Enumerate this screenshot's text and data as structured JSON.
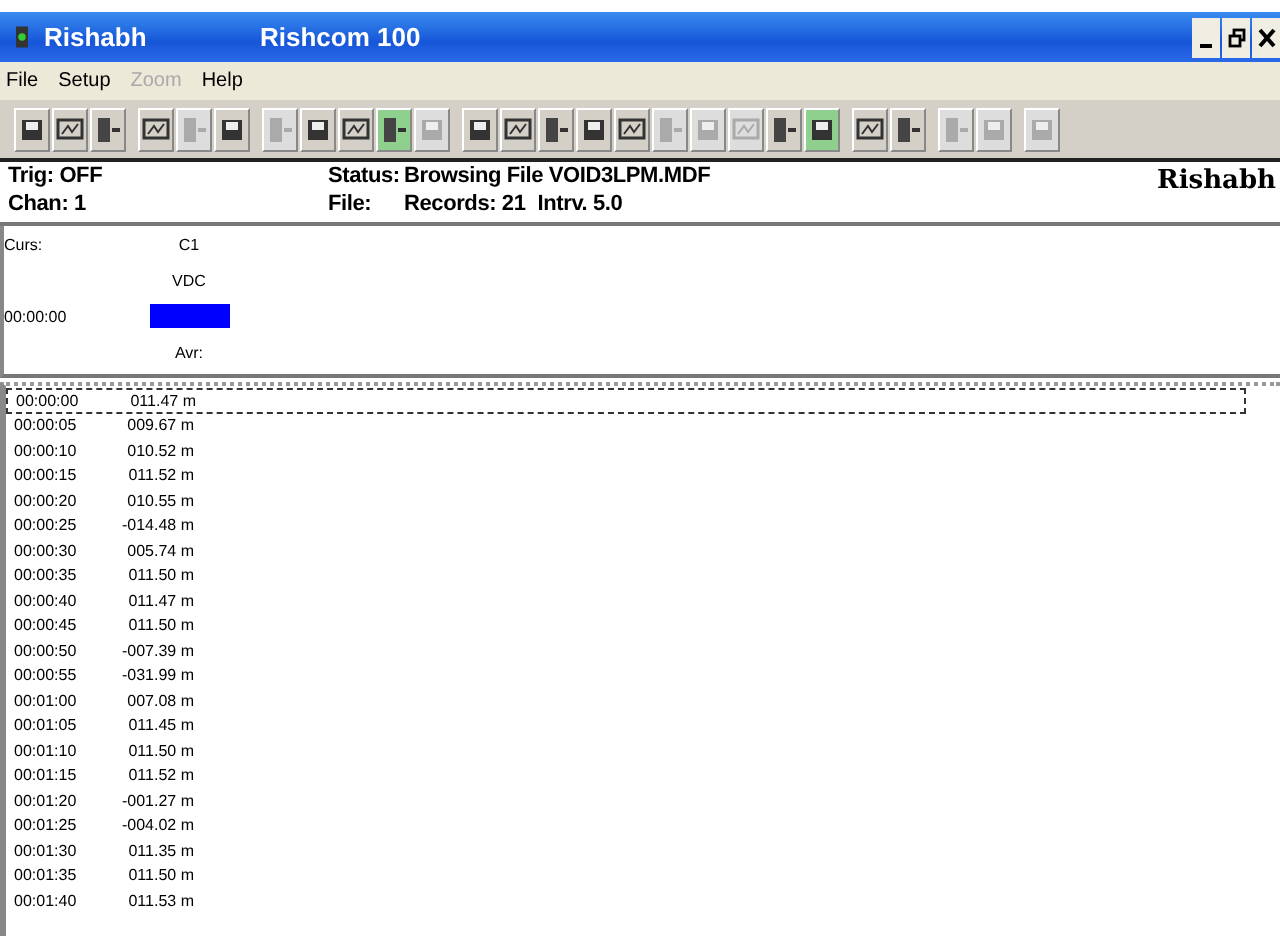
{
  "window": {
    "app_name": "Rishabh",
    "title": "Rishcom 100"
  },
  "menu": [
    {
      "label": "File",
      "disabled": false
    },
    {
      "label": "Setup",
      "disabled": false
    },
    {
      "label": "Zoom",
      "disabled": true
    },
    {
      "label": "Help",
      "disabled": false
    }
  ],
  "toolbar": [
    [
      {
        "disabled": false,
        "active": false
      },
      {
        "disabled": false,
        "active": false
      },
      {
        "disabled": false,
        "active": false
      }
    ],
    [
      {
        "disabled": false,
        "active": false
      },
      {
        "disabled": true,
        "active": false
      },
      {
        "disabled": false,
        "active": false
      }
    ],
    [
      {
        "disabled": true,
        "active": false
      },
      {
        "disabled": false,
        "active": false
      },
      {
        "disabled": false,
        "active": false
      },
      {
        "disabled": false,
        "active": true
      },
      {
        "disabled": true,
        "active": false
      }
    ],
    [
      {
        "disabled": false,
        "active": false
      },
      {
        "disabled": false,
        "active": false
      },
      {
        "disabled": false,
        "active": false
      },
      {
        "disabled": false,
        "active": false
      },
      {
        "disabled": false,
        "active": false
      },
      {
        "disabled": true,
        "active": false
      },
      {
        "disabled": true,
        "active": false
      },
      {
        "disabled": true,
        "active": false
      },
      {
        "disabled": false,
        "active": false
      },
      {
        "disabled": false,
        "active": true
      }
    ],
    [
      {
        "disabled": false,
        "active": false
      },
      {
        "disabled": false,
        "active": false
      }
    ],
    [
      {
        "disabled": true,
        "active": false
      },
      {
        "disabled": true,
        "active": false
      }
    ],
    [
      {
        "disabled": true,
        "active": false
      }
    ]
  ],
  "info": {
    "trig": "Trig: OFF",
    "chan": "Chan: 1",
    "status_label": "Status:",
    "status": "Browsing File VOID3LPM.MDF",
    "file_label": "File:",
    "records": "Records: 21",
    "interval": "Intrv. 5.0",
    "logo": "Rishabh"
  },
  "cursor_panel": {
    "label": "Curs:",
    "channel": "C1",
    "unit": "VDC",
    "time": "00:00:00",
    "average_label": "Avr:"
  },
  "rows": [
    {
      "time": "00:00:00",
      "value": "011.47 m",
      "selected": true
    },
    {
      "time": "00:00:05",
      "value": "009.67 m",
      "selected": false
    },
    {
      "time": "00:00:10",
      "value": "010.52 m",
      "selected": false
    },
    {
      "time": "00:00:15",
      "value": "011.52 m",
      "selected": false
    },
    {
      "time": "00:00:20",
      "value": "010.55 m",
      "selected": false
    },
    {
      "time": "00:00:25",
      "value": "-014.48 m",
      "selected": false
    },
    {
      "time": "00:00:30",
      "value": "005.74 m",
      "selected": false
    },
    {
      "time": "00:00:35",
      "value": "011.50 m",
      "selected": false
    },
    {
      "time": "00:00:40",
      "value": "011.47 m",
      "selected": false
    },
    {
      "time": "00:00:45",
      "value": "011.50 m",
      "selected": false
    },
    {
      "time": "00:00:50",
      "value": "-007.39 m",
      "selected": false
    },
    {
      "time": "00:00:55",
      "value": "-031.99 m",
      "selected": false
    },
    {
      "time": "00:01:00",
      "value": "007.08 m",
      "selected": false
    },
    {
      "time": "00:01:05",
      "value": "011.45 m",
      "selected": false
    },
    {
      "time": "00:01:10",
      "value": "011.50 m",
      "selected": false
    },
    {
      "time": "00:01:15",
      "value": "011.52 m",
      "selected": false
    },
    {
      "time": "00:01:20",
      "value": "-001.27 m",
      "selected": false
    },
    {
      "time": "00:01:25",
      "value": "-004.02 m",
      "selected": false
    },
    {
      "time": "00:01:30",
      "value": "011.35 m",
      "selected": false
    },
    {
      "time": "00:01:35",
      "value": "011.50 m",
      "selected": false
    },
    {
      "time": "00:01:40",
      "value": "011.53 m",
      "selected": false
    }
  ]
}
